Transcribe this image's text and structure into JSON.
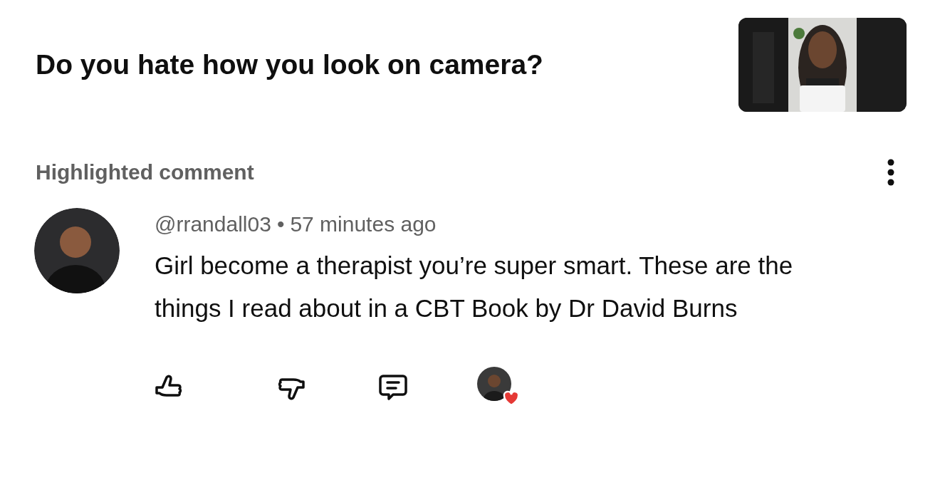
{
  "video": {
    "title": "Do you hate how you look on camera?"
  },
  "section_label": "Highlighted comment",
  "comment": {
    "author": "@rrandall03",
    "separator": "•",
    "time": "57 minutes ago",
    "text": "Girl become a therapist you’re super smart. These are the things I read about in a CBT Book by Dr David Burns",
    "hearted_by_creator": true
  }
}
